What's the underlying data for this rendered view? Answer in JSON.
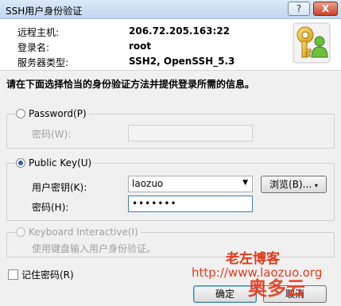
{
  "window": {
    "title": "SSH用户身份验证",
    "help_label": "?",
    "close_label": "X"
  },
  "info": {
    "host_label": "远程主机:",
    "host_value": "206.72.205.163:22",
    "user_label": "登录名:",
    "user_value": "root",
    "server_label": "服务器类型:",
    "server_value": "SSH2, OpenSSH_5.3"
  },
  "instruction": "请在下面选择恰当的身份验证方法并提供登录所需的信息。",
  "password_method": {
    "label": "Password(P)",
    "selected": false,
    "field_label": "密码(W):",
    "value": ""
  },
  "publickey_method": {
    "label": "Public Key(U)",
    "selected": true,
    "key_label": "用户密钥(K):",
    "key_value": "laozuo",
    "browse_label": "浏览(B)...",
    "passphrase_label": "密码(H):",
    "passphrase_value": "•••••••"
  },
  "keyboard_method": {
    "label": "Keyboard Interactive(I)",
    "selected": false,
    "hint": "使用键盘输入用户身份验证。"
  },
  "remember": {
    "label": "记住密码(R)",
    "checked": false
  },
  "buttons": {
    "ok_label": "确定",
    "cancel_label": "取消"
  },
  "watermark": {
    "line1": "老左博客",
    "line2": "http://www.laozuo.org",
    "line3": "奥多云"
  },
  "colors": {
    "accent": "#2a5fb0",
    "watermark": "#e4391a"
  }
}
